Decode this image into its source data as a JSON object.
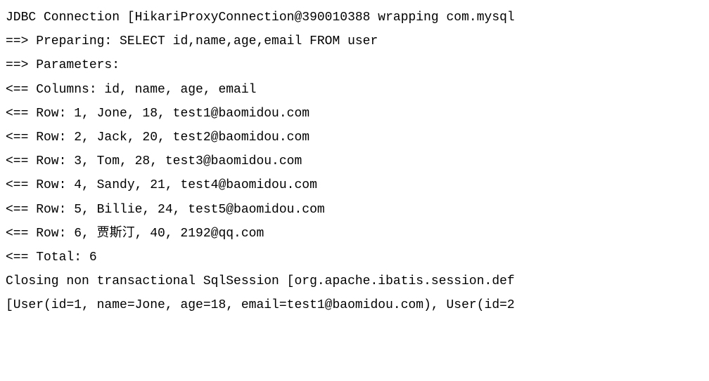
{
  "lines": {
    "connection": "JDBC Connection [HikariProxyConnection@390010388 wrapping com.mysql",
    "preparing": "==>  Preparing: SELECT id,name,age,email FROM user",
    "parameters": "==> Parameters:",
    "columns": "<==    Columns: id, name, age, email",
    "row1": "<==        Row: 1, Jone, 18, test1@baomidou.com",
    "row2": "<==        Row: 2, Jack, 20, test2@baomidou.com",
    "row3": "<==        Row: 3, Tom, 28, test3@baomidou.com",
    "row4": "<==        Row: 4, Sandy, 21, test4@baomidou.com",
    "row5": "<==        Row: 5, Billie, 24, test5@baomidou.com",
    "row6": "<==        Row: 6, 贾斯汀, 40, 2192@qq.com",
    "total": "<==      Total: 6",
    "closing": "Closing non transactional SqlSession [org.apache.ibatis.session.def",
    "userlist": "[User(id=1, name=Jone, age=18, email=test1@baomidou.com), User(id=2"
  }
}
